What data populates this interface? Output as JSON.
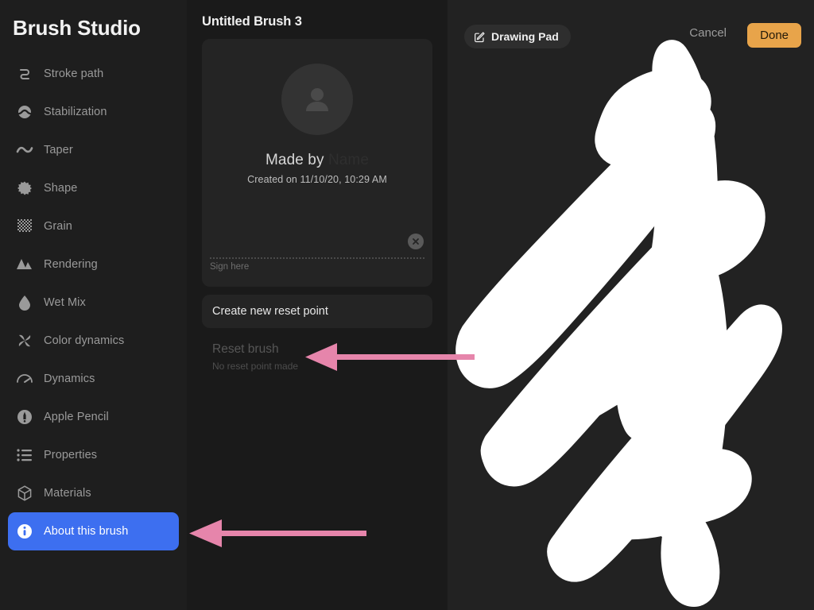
{
  "sidebar": {
    "title": "Brush Studio",
    "items": [
      {
        "label": "Stroke path",
        "icon": "stroke-path-icon",
        "active": false
      },
      {
        "label": "Stabilization",
        "icon": "stabilization-icon",
        "active": false
      },
      {
        "label": "Taper",
        "icon": "taper-icon",
        "active": false
      },
      {
        "label": "Shape",
        "icon": "shape-icon",
        "active": false
      },
      {
        "label": "Grain",
        "icon": "grain-icon",
        "active": false
      },
      {
        "label": "Rendering",
        "icon": "rendering-icon",
        "active": false
      },
      {
        "label": "Wet Mix",
        "icon": "wet-mix-icon",
        "active": false
      },
      {
        "label": "Color dynamics",
        "icon": "color-dynamics-icon",
        "active": false
      },
      {
        "label": "Dynamics",
        "icon": "dynamics-icon",
        "active": false
      },
      {
        "label": "Apple Pencil",
        "icon": "apple-pencil-icon",
        "active": false
      },
      {
        "label": "Properties",
        "icon": "properties-icon",
        "active": false
      },
      {
        "label": "Materials",
        "icon": "materials-icon",
        "active": false
      },
      {
        "label": "About this brush",
        "icon": "info-icon",
        "active": true
      }
    ],
    "active_color": "#3d6ff0"
  },
  "middle": {
    "brush_name": "Untitled Brush 3",
    "about_card": {
      "avatar_icon": "person-icon",
      "made_by_label": "Made by",
      "made_by_placeholder": "Name",
      "created_on": "Created on 11/10/20, 10:29 AM",
      "sign_here_placeholder": "Sign here",
      "clear_signature_icon": "close-circle-icon"
    },
    "create_reset_point_label": "Create new reset point",
    "reset_brush_label": "Reset brush",
    "reset_brush_subtitle": "No reset point made"
  },
  "right": {
    "drawing_pad_label": "Drawing Pad",
    "drawing_pad_icon": "compose-icon",
    "cancel_label": "Cancel",
    "done_label": "Done",
    "done_color": "#e8a44a",
    "stroke_color": "#ffffff",
    "canvas_background": "#222222"
  },
  "annotations": {
    "arrow_color": "#e685ab",
    "arrows": [
      {
        "name": "arrow-to-reset-brush",
        "points_to": "Reset brush"
      },
      {
        "name": "arrow-to-about-this-brush",
        "points_to": "About this brush"
      }
    ]
  }
}
